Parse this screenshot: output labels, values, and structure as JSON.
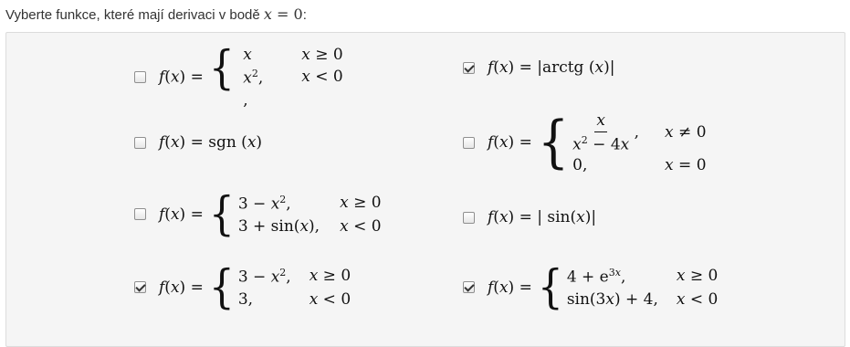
{
  "question": {
    "text": "Vyberte funkce, které mají derivaci v bodě",
    "var": "x",
    "eq": " = 0",
    "colon": ":"
  },
  "options": [
    {
      "checked": false,
      "desc": "f(x) = { x, x ≥ 0 ; x^2, x < 0 }"
    },
    {
      "checked": true,
      "desc": "f(x) = |arctg(x)|"
    },
    {
      "checked": false,
      "desc": "f(x) = sgn(x)"
    },
    {
      "checked": false,
      "desc": "f(x) = { x/(x^2 − 4x), x ≠ 0 ; 0, x = 0 }"
    },
    {
      "checked": false,
      "desc": "f(x) = { 3 − x^2, x ≥ 0 ; 3 + sin(x), x < 0 }"
    },
    {
      "checked": false,
      "desc": "f(x) = |sin(x)|"
    },
    {
      "checked": true,
      "desc": "f(x) = { 3 − x^2, x ≥ 0 ; 3, x < 0 }"
    },
    {
      "checked": true,
      "desc": "f(x) = { 4 + e^{3x}, x ≥ 0 ; sin(3x) + 4, x < 0 }"
    }
  ]
}
